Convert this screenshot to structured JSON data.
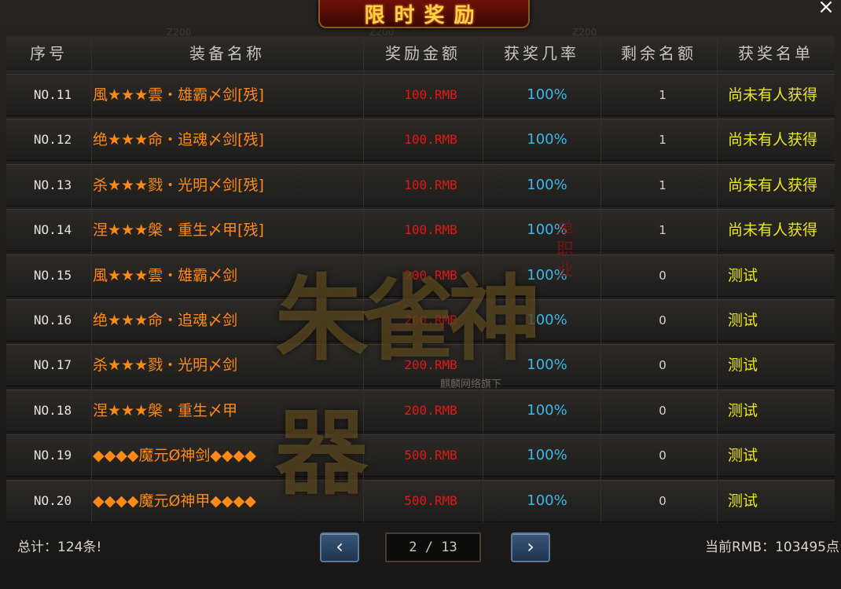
{
  "window": {
    "title": "限时奖励",
    "close_label": "×",
    "faint_numbers": [
      "Z200",
      "Z200",
      "Z200"
    ]
  },
  "table": {
    "headers": [
      "序号",
      "装备名称",
      "奖励金额",
      "获奖几率",
      "剩余名额",
      "获奖名单"
    ],
    "rows": [
      {
        "no": "NO.11",
        "name": "風★★★雲・雄霸〆剑[残]",
        "amount": "100.RMB",
        "rate": "100%",
        "remaining": "1",
        "winner": "尚未有人获得"
      },
      {
        "no": "NO.12",
        "name": "绝★★★命・追魂〆剑[残]",
        "amount": "100.RMB",
        "rate": "100%",
        "remaining": "1",
        "winner": "尚未有人获得"
      },
      {
        "no": "NO.13",
        "name": "杀★★★戮・光明〆剑[残]",
        "amount": "100.RMB",
        "rate": "100%",
        "remaining": "1",
        "winner": "尚未有人获得"
      },
      {
        "no": "NO.14",
        "name": "涅★★★槃・重生〆甲[残]",
        "amount": "100.RMB",
        "rate": "100%",
        "remaining": "1",
        "winner": "尚未有人获得"
      },
      {
        "no": "NO.15",
        "name": "風★★★雲・雄霸〆剑",
        "amount": "200.RMB",
        "rate": "100%",
        "remaining": "0",
        "winner": "测试"
      },
      {
        "no": "NO.16",
        "name": "绝★★★命・追魂〆剑",
        "amount": "200.RMB",
        "rate": "100%",
        "remaining": "0",
        "winner": "测试"
      },
      {
        "no": "NO.17",
        "name": "杀★★★戮・光明〆剑",
        "amount": "200.RMB",
        "rate": "100%",
        "remaining": "0",
        "winner": "测试"
      },
      {
        "no": "NO.18",
        "name": "涅★★★槃・重生〆甲",
        "amount": "200.RMB",
        "rate": "100%",
        "remaining": "0",
        "winner": "测试"
      },
      {
        "no": "NO.19",
        "name": "◆◆◆◆魔元Ø神剑◆◆◆◆",
        "amount": "500.RMB",
        "rate": "100%",
        "remaining": "0",
        "winner": "测试"
      },
      {
        "no": "NO.20",
        "name": "◆◆◆◆魔元Ø神甲◆◆◆◆",
        "amount": "500.RMB",
        "rate": "100%",
        "remaining": "0",
        "winner": "测试"
      }
    ]
  },
  "watermark": {
    "main": "朱雀神器",
    "side": "单职业",
    "sub": "麒麟网络旗下"
  },
  "footer": {
    "total": "总计：124条!",
    "page": "2 / 13",
    "prev_label": "‹",
    "next_label": "›",
    "current_rmb": "当前RMB：103495点"
  },
  "colors": {
    "item_name": "#ff8a16",
    "amount": "#e01818",
    "rate": "#38b8ea",
    "winner": "#e8e81a",
    "title": "#ffd24a"
  }
}
